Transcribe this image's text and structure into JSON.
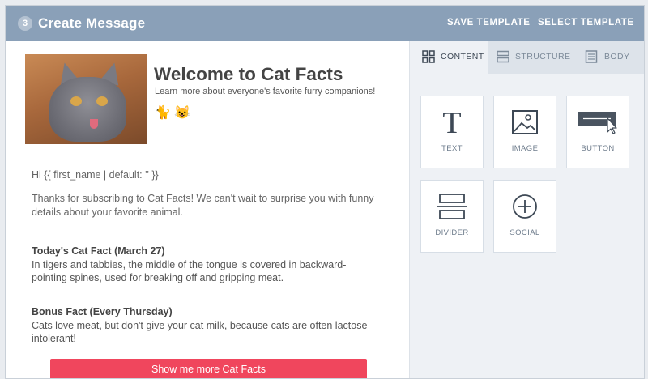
{
  "header": {
    "step": "3",
    "title": "Create Message",
    "save_template": "SAVE TEMPLATE",
    "select_template": "SELECT TEMPLATE"
  },
  "preview": {
    "heading": "Welcome to Cat Facts",
    "subheading": "Learn more about everyone's favorite furry companions!",
    "emoji": "🐈 😺",
    "greeting": "Hi {{ first_name | default: '' }}",
    "intro": "Thanks for subscribing to Cat Facts! We can't wait to surprise you with funny details about your favorite animal.",
    "facts": [
      {
        "title": "Today's Cat Fact (March 27)",
        "text": "In tigers and tabbies, the middle of the tongue is covered in backward-pointing spines, used for breaking off and gripping meat."
      },
      {
        "title": "Bonus Fact (Every Thursday)",
        "text": "Cats love meat, but don't give your cat milk, because cats are often lactose intolerant!"
      }
    ],
    "cta": "Show me more Cat Facts"
  },
  "panel": {
    "tabs": [
      {
        "label": "CONTENT",
        "icon": "grid-icon",
        "active": true
      },
      {
        "label": "STRUCTURE",
        "icon": "structure-icon",
        "active": false
      },
      {
        "label": "BODY",
        "icon": "body-icon",
        "active": false
      }
    ],
    "blocks": [
      {
        "label": "TEXT",
        "icon": "text-icon"
      },
      {
        "label": "IMAGE",
        "icon": "image-icon"
      },
      {
        "label": "BUTTON",
        "icon": "button-icon"
      },
      {
        "label": "DIVIDER",
        "icon": "divider-icon"
      },
      {
        "label": "SOCIAL",
        "icon": "social-icon"
      }
    ]
  },
  "colors": {
    "header_bg": "#8aa0b8",
    "cta_bg": "#f0465d",
    "panel_bg": "#eef1f5"
  }
}
